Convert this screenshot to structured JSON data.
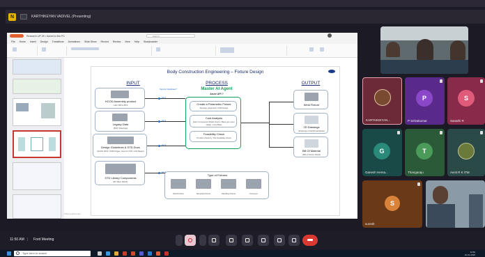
{
  "meeting": {
    "app_icon_glyph": "N",
    "presenter_label": "KARTHIKEYAN VADIVEL (Presenting)",
    "time": "11:50 AM",
    "separator": "|",
    "meeting_name": "Ford Meeting"
  },
  "ppt": {
    "filename": "Research UP 25  •  Saved to this PC",
    "search_placeholder": "Search",
    "tabs": [
      "File",
      "Home",
      "Insert",
      "Design",
      "Transitions",
      "Animations",
      "Slide Show",
      "Record",
      "Review",
      "View",
      "Help",
      "Storyboarder"
    ],
    "status_text": "Click to add notes"
  },
  "slide": {
    "title": "Body Construction Engineering – Fixture Design",
    "input_heading": "INPUT",
    "process_heading": "PROCESS",
    "output_heading": "OUTPUT",
    "agent_title": "Master AI Agent",
    "agent_sub": "Azure API ?",
    "vendor_label": "Vendor Database?",
    "inputs": [
      {
        "label": "HCOD Assembly product",
        "sub": "CAD, BIP & BTS"
      },
      {
        "label": "Legacy Data",
        "sub": "(BOP, Drawings)"
      },
      {
        "label": "Design Guidelines & STD Docs",
        "sub": "(ECDS 2015 / 2016 Pages, Generic STD / GM Pages)"
      },
      {
        "label": "STD Library Components",
        "sub": "(BT, BLR, BUFF)"
      }
    ],
    "process_steps": [
      {
        "label": "Create a Parametric Fixture",
        "sub": "Develop parametric CAD Design"
      },
      {
        "label": "Cost Analysis",
        "sub": "Each Component Model check • Base gen open shape • Cost Base"
      },
      {
        "label": "Feasibility Check",
        "sub": "Product Check by The Feasibility check"
      }
    ],
    "outputs": [
      {
        "label": "Weld Fixture"
      },
      {
        "label": "2D Drawings",
        "sub": "(Drawings of Part/Final Model)"
      },
      {
        "label": "Bill Of Material",
        "sub": "(Bill of Fixture Detail)"
      }
    ],
    "fixture_types_title": "Type of Fixtures",
    "fixture_types": [
      "Weld Fixture",
      "Sampled Fixture",
      "Handling Fixture",
      "Conveyor"
    ],
    "conn_labels": [
      "A2-1",
      "A2-2",
      "A2-3",
      "A2-4"
    ]
  },
  "participants": [
    {
      "name": "KARTHIKEYAN...",
      "initial": "",
      "color": "#6b2a35",
      "avatar_color": "#7a4a30",
      "kind": "photo"
    },
    {
      "name": "P Selvakumar",
      "initial": "P",
      "color": "#5a2a8a",
      "avatar_color": "#8a48c8",
      "kind": "letter"
    },
    {
      "name": "Sanathi R",
      "initial": "S",
      "color": "#8a2a4a",
      "avatar_color": "#e05a7a",
      "kind": "letter"
    },
    {
      "name": "Ganesh Hema...",
      "initial": "G",
      "color": "#1a4a48",
      "avatar_color": "#2a8a7a",
      "kind": "letter"
    },
    {
      "name": "Thangaraju",
      "initial": "T",
      "color": "#2a5a38",
      "avatar_color": "#4a9a5a",
      "kind": "letter"
    },
    {
      "name": "Avnit R K ITM",
      "initial": "",
      "color": "#2a4a48",
      "avatar_color": "#6a7a3a",
      "kind": "photo"
    },
    {
      "name": "suresh",
      "initial": "S",
      "color": "#6a3a18",
      "avatar_color": "#d8823a",
      "kind": "letter"
    }
  ],
  "taskbar": {
    "search_placeholder": "Type here to search",
    "clock_time": "11:50",
    "clock_date": "10-01-2025"
  },
  "colors": {
    "mic_active": "#e9c9cf",
    "hangup": "#d83a32",
    "slide_title": "#1a2a6e",
    "agent_green": "#14a05a"
  }
}
